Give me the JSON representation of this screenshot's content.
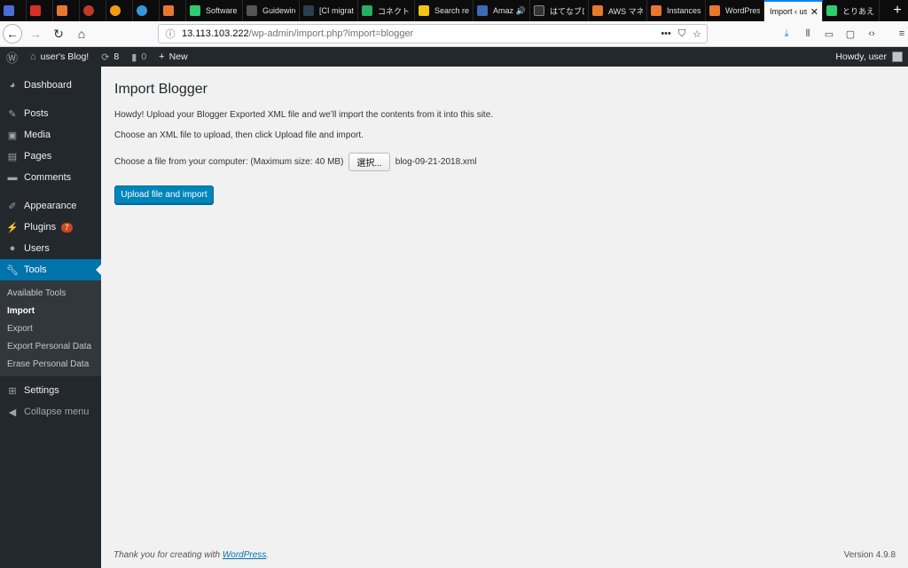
{
  "browser": {
    "tabs": [
      {
        "label": "",
        "color": "#4a6cd4"
      },
      {
        "label": "",
        "color": "#d93025"
      },
      {
        "label": "",
        "color": "#e8772e"
      },
      {
        "label": "",
        "color": "#c0392b"
      },
      {
        "label": "",
        "color": "#f39c12"
      },
      {
        "label": "",
        "color": "#3498db"
      },
      {
        "label": "",
        "color": "#e8772e"
      },
      {
        "label": "Software",
        "color": "#2ecc71"
      },
      {
        "label": "Guidewire",
        "color": "#555555"
      },
      {
        "label": "[CI migrat",
        "color": "#2c3e50"
      },
      {
        "label": "コネクト",
        "color": "#27ae60"
      },
      {
        "label": "Search re",
        "color": "#f1c40f"
      },
      {
        "label": "Amaz",
        "color": "#3d6bb3"
      },
      {
        "label": "はてなブロ",
        "color": "#333333"
      },
      {
        "label": "AWS マネ",
        "color": "#e8772e"
      },
      {
        "label": "Instances",
        "color": "#e8772e"
      },
      {
        "label": "WordPres",
        "color": "#e8772e"
      },
      {
        "label": "Import ‹ us",
        "color": "",
        "active": true
      },
      {
        "label": "とりあえ",
        "color": "#2ecc71"
      }
    ],
    "url_host": "13.113.103.222",
    "url_path": "/wp-admin/import.php?import=blogger"
  },
  "adminbar": {
    "site_name": "user's Blog!",
    "updates_count": "8",
    "comments_count": "0",
    "new_label": "New",
    "howdy": "Howdy, user"
  },
  "sidebar": {
    "items": [
      {
        "label": "Dashboard",
        "icon": "dashboard-icon"
      },
      {
        "label": "Posts",
        "icon": "pin-icon"
      },
      {
        "label": "Media",
        "icon": "media-icon"
      },
      {
        "label": "Pages",
        "icon": "pages-icon"
      },
      {
        "label": "Comments",
        "icon": "comment-icon"
      },
      {
        "label": "Appearance",
        "icon": "brush-icon"
      },
      {
        "label": "Plugins",
        "icon": "plugin-icon",
        "badge": "7"
      },
      {
        "label": "Users",
        "icon": "user-icon"
      },
      {
        "label": "Tools",
        "icon": "wrench-icon"
      },
      {
        "label": "Settings",
        "icon": "settings-icon"
      },
      {
        "label": "Collapse menu",
        "icon": "collapse-icon"
      }
    ],
    "submenu": [
      "Available Tools",
      "Import",
      "Export",
      "Export Personal Data",
      "Erase Personal Data"
    ]
  },
  "main": {
    "title": "Import Blogger",
    "intro": "Howdy! Upload your Blogger Exported XML file and we’ll import the contents from it into this site.",
    "instruction": "Choose an XML file to upload, then click Upload file and import.",
    "file_label": "Choose a file from your computer: (Maximum size: 40 MB)",
    "choose_button": "選択...",
    "file_name": "blog-09-21-2018.xml",
    "submit_label": "Upload file and import"
  },
  "footer": {
    "thanks_prefix": "Thank you for creating with ",
    "thanks_link": "WordPress",
    "thanks_suffix": ".",
    "version": "Version 4.9.8"
  },
  "colors": {
    "admin_dark": "#23282d",
    "accent": "#0073aa",
    "button": "#0085ba",
    "badge": "#ca4a1f"
  }
}
